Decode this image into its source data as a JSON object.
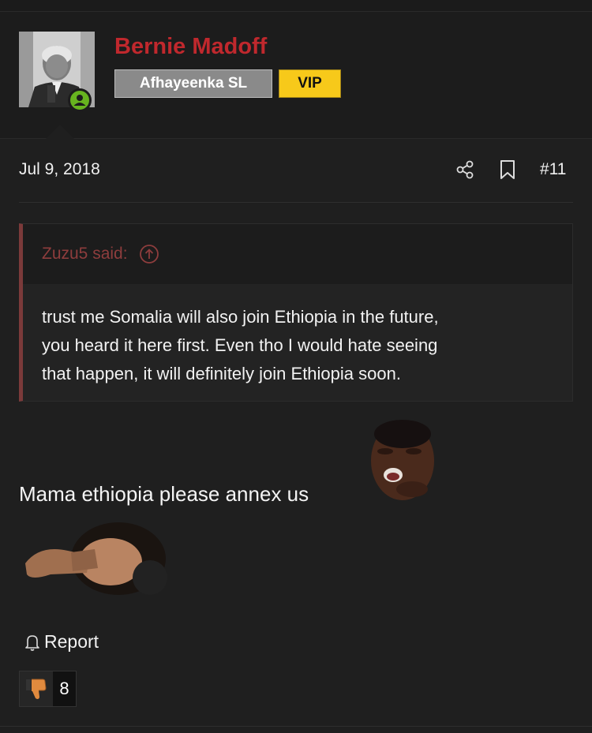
{
  "post": {
    "author": {
      "name": "Bernie Madoff",
      "title_badge": "Afhayeenka SL",
      "vip_badge": "VIP",
      "online": true
    },
    "date": "Jul 9, 2018",
    "post_number": "#11",
    "icons": {
      "share": "share-icon",
      "bookmark": "bookmark-icon",
      "quote_up": "arrow-up-circle-icon",
      "report": "bell-icon",
      "reaction": "thumbs-down-icon"
    },
    "quote": {
      "header": "Zuzu5 said:",
      "lines": [
        "trust me Somalia will also join Ethiopia in the future,",
        "you heard it here first. Even tho I would hate seeing",
        "that happen, it will definitely join Ethiopia soon."
      ]
    },
    "message": "Mama ethiopia please annex us",
    "report_label": "Report",
    "reaction_count": "8"
  },
  "colors": {
    "background": "#1f1f1f",
    "username": "#c0282d",
    "vip": "#f7c91a",
    "online": "#67b31f",
    "quote_accent": "#7b3a3a"
  }
}
